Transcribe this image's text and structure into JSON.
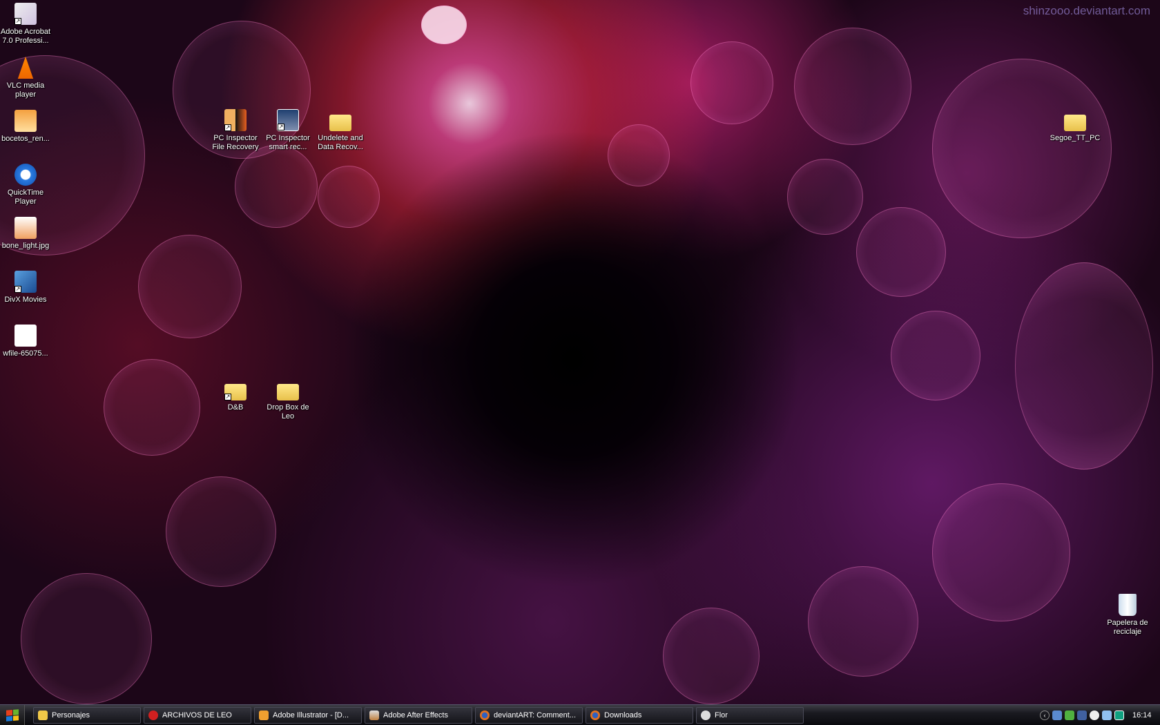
{
  "watermark": "shinzooo.deviantart.com",
  "desktop_icons": [
    {
      "label": "Adobe Acrobat 7.0 Professi...",
      "icon": "acrobat-icon",
      "shortcut": true
    },
    {
      "label": "VLC media player",
      "icon": "vlc-cone-icon",
      "shortcut": true
    },
    {
      "label": "bocetos_ren...",
      "icon": "illustrator-file-icon",
      "shortcut": false
    },
    {
      "label": "QuickTime Player",
      "icon": "quicktime-icon",
      "shortcut": true
    },
    {
      "label": "bone_light.jpg",
      "icon": "image-file-icon",
      "shortcut": false
    },
    {
      "label": "DivX Movies",
      "icon": "divx-icon",
      "shortcut": true
    },
    {
      "label": "wfile-65075...",
      "icon": "vlc-file-icon",
      "shortcut": false
    },
    {
      "label": "PC Inspector File Recovery",
      "icon": "file-recovery-icon",
      "shortcut": true
    },
    {
      "label": "PC Inspector smart rec...",
      "icon": "smart-recovery-icon",
      "shortcut": true
    },
    {
      "label": "Undelete and Data Recov...",
      "icon": "folder-icon",
      "shortcut": false
    },
    {
      "label": "Segoe_TT_PC",
      "icon": "folder-icon",
      "shortcut": false
    },
    {
      "label": "D&B",
      "icon": "folder-icon",
      "shortcut": true
    },
    {
      "label": "Drop Box de Leo",
      "icon": "shared-folder-icon",
      "shortcut": false
    },
    {
      "label": "Papelera de reciclaje",
      "icon": "recycle-bin-icon",
      "shortcut": false
    }
  ],
  "taskbar": {
    "buttons": [
      {
        "label": "Personajes",
        "icon": "folder-icon",
        "color": "#f0c848"
      },
      {
        "label": "ARCHIVOS DE LEO",
        "icon": "no-entry-icon",
        "color": "#d02020"
      },
      {
        "label": "Adobe Illustrator - [D...",
        "icon": "illustrator-icon",
        "color": "#f0a030"
      },
      {
        "label": "Adobe After Effects",
        "icon": "after-effects-icon",
        "color": "#c08040"
      },
      {
        "label": "deviantART: Comment...",
        "icon": "firefox-icon",
        "color": "#e07020"
      },
      {
        "label": "Downloads",
        "icon": "firefox-icon",
        "color": "#e07020"
      },
      {
        "label": "Flor",
        "icon": "chat-bubble-icon",
        "color": "#dddddd"
      }
    ],
    "tray_icons": [
      "expand-arrow-icon",
      "messenger-icon",
      "msn-icon",
      "network-icon",
      "balloon-icon",
      "notes-icon",
      "sync-icon"
    ],
    "clock": "16:14"
  }
}
